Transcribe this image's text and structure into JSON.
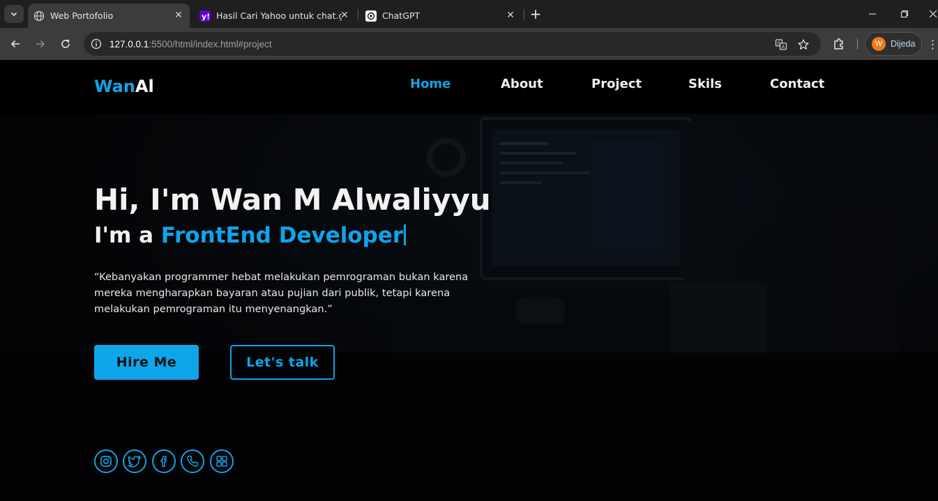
{
  "browser": {
    "tabs": [
      {
        "title": "Web Portofolio",
        "active": true,
        "favicon": "globe-icon"
      },
      {
        "title": "Hasil Cari Yahoo untuk chat.gpt",
        "active": false,
        "favicon": "yahoo-icon"
      },
      {
        "title": "ChatGPT",
        "active": false,
        "favicon": "chatgpt-icon"
      }
    ],
    "url_host": "127.0.0.1",
    "url_path": ":5500/html/index.html#project",
    "profile_initial": "W",
    "profile_name": "Dijeda"
  },
  "site": {
    "logo_part1": "Wan",
    "logo_part2": "Al",
    "nav": [
      {
        "label": "Home",
        "active": true
      },
      {
        "label": "About",
        "active": false
      },
      {
        "label": "Project",
        "active": false
      },
      {
        "label": "Skils",
        "active": false
      },
      {
        "label": "Contact",
        "active": false
      }
    ],
    "hero": {
      "title": "Hi, I'm Wan M Alwaliyyu",
      "sub_prefix": "I'm a ",
      "sub_role": "FrontEnd Developer",
      "quote": "“Kebanyakan programmer hebat melakukan pemrograman bukan karena mereka mengharapkan bayaran atau pujian dari publik, tetapi karena melakukan pemrograman itu menyenangkan.”",
      "hire_label": "Hire Me",
      "talk_label": "Let's talk"
    },
    "social_icons": [
      "instagram-icon",
      "twitter-icon",
      "facebook-icon",
      "phone-icon",
      "grid-icon"
    ],
    "colors": {
      "accent": "#0ea5ea",
      "background": "#000000",
      "text": "#f2f2f2"
    }
  }
}
